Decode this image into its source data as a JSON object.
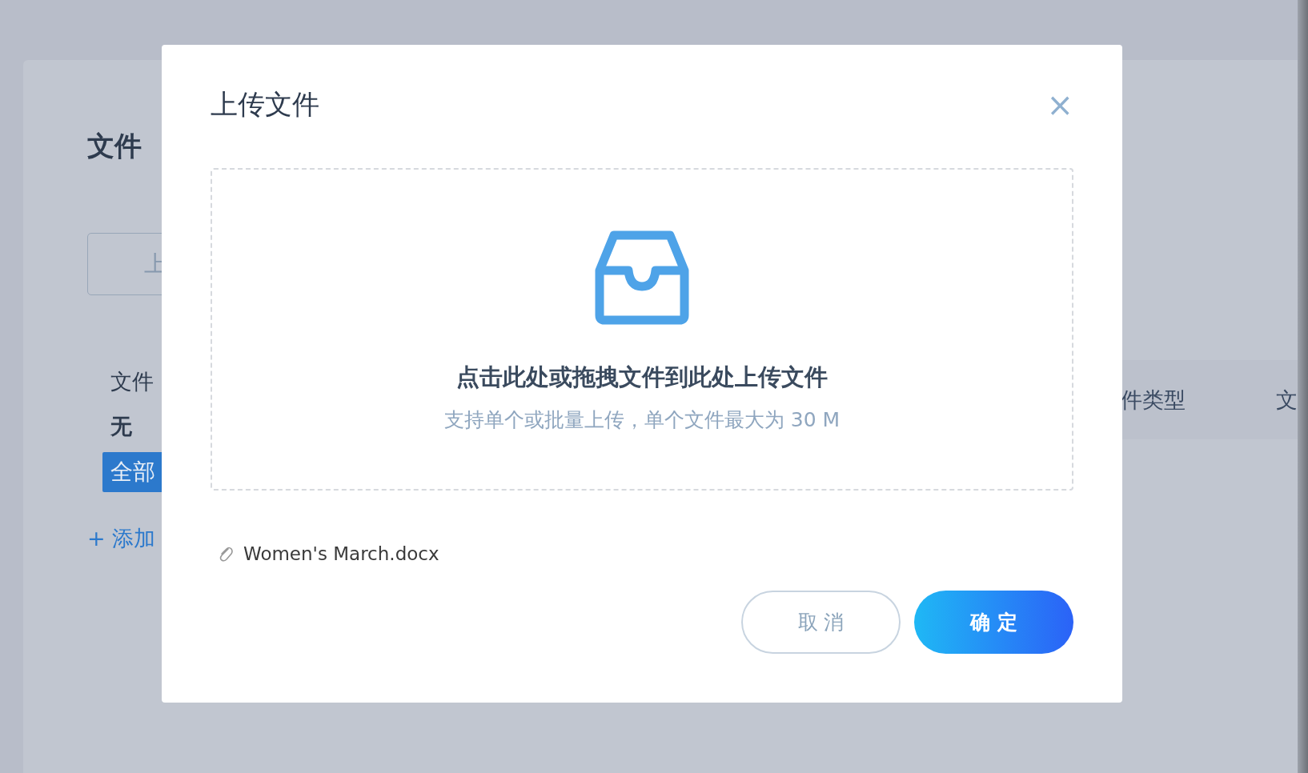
{
  "page": {
    "title": "文件",
    "upload_button": "上",
    "category_label": "文件",
    "category_none": "无",
    "categories": [
      {
        "label": "全部",
        "selected": true
      }
    ],
    "add_category": "+ 添加",
    "table": {
      "columns": [
        "件类型",
        "文"
      ]
    }
  },
  "dialog": {
    "title": "上传文件",
    "close": "×",
    "dropzone": {
      "text": "点击此处或拖拽文件到此处上传文件",
      "hint": "支持单个或批量上传，单个文件最大为 30 M"
    },
    "files": [
      {
        "name": "Women's March.docx"
      }
    ],
    "buttons": [
      {
        "label": "取 消",
        "kind": "secondary"
      },
      {
        "label": "确 定",
        "kind": "primary"
      }
    ]
  }
}
